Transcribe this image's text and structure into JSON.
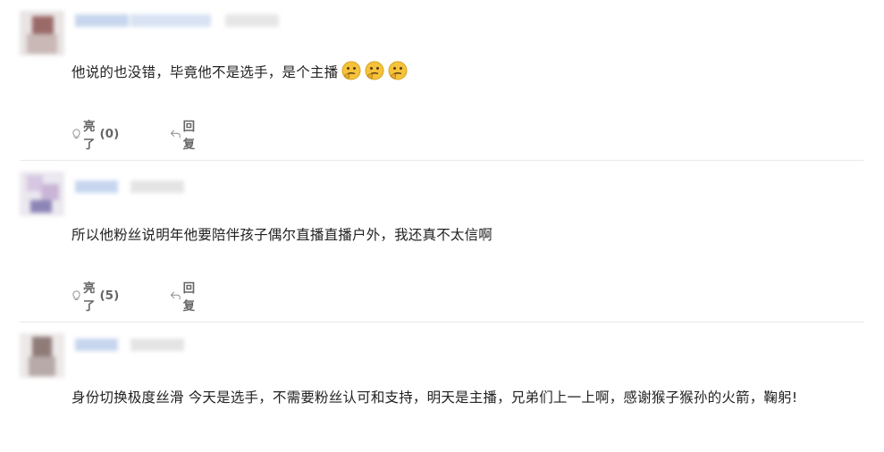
{
  "comments": [
    {
      "text": "他说的也没错，毕竟他不是选手，是个主播",
      "emoji_count": 3,
      "like_label": "亮了",
      "like_count": "(0)",
      "reply_label": "回复"
    },
    {
      "text": "所以他粉丝说明年他要陪伴孩子偶尔直播直播户外，我还真不太信啊",
      "like_label": "亮了",
      "like_count": "(5)",
      "reply_label": "回复"
    },
    {
      "text": "身份切换极度丝滑 今天是选手，不需要粉丝认可和支持，明天是主播，兄弟们上一上啊，感谢猴子猴孙的火箭，鞠躬!"
    }
  ],
  "colors": {
    "text": "#222222",
    "action_text": "#666666",
    "divider": "#e8e8e8",
    "emoji_face": "#f5c33b"
  },
  "icons": {
    "like": "lightbulb-icon",
    "reply": "reply-arrow-icon",
    "emoji": "thinking-face-emoji"
  }
}
